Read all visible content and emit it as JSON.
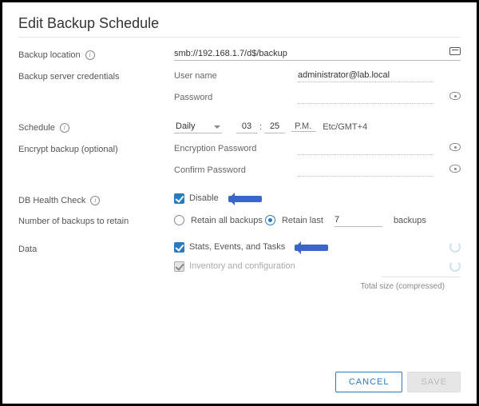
{
  "title": "Edit Backup Schedule",
  "labels": {
    "backup_location": "Backup location",
    "backup_creds": "Backup server credentials",
    "username": "User name",
    "password": "Password",
    "schedule": "Schedule",
    "encrypt": "Encrypt backup (optional)",
    "enc_pw": "Encryption Password",
    "conf_pw": "Confirm Password",
    "db_health": "DB Health Check",
    "retain": "Number of backups to retain",
    "data": "Data",
    "total": "Total size (compressed)"
  },
  "values": {
    "location": "smb://192.168.1.7/d$/backup",
    "username": "administrator@lab.local",
    "freq": "Daily",
    "hour": "03",
    "minute": "25",
    "ampm": "P.M.",
    "tz": "Etc/GMT+4",
    "retain_last": "7"
  },
  "options": {
    "disable": "Disable",
    "retain_all": "Retain all backups",
    "retain_last_pre": "Retain last",
    "retain_last_post": "backups",
    "stats": "Stats, Events, and Tasks",
    "inventory": "Inventory and configuration"
  },
  "buttons": {
    "cancel": "CANCEL",
    "save": "SAVE"
  }
}
